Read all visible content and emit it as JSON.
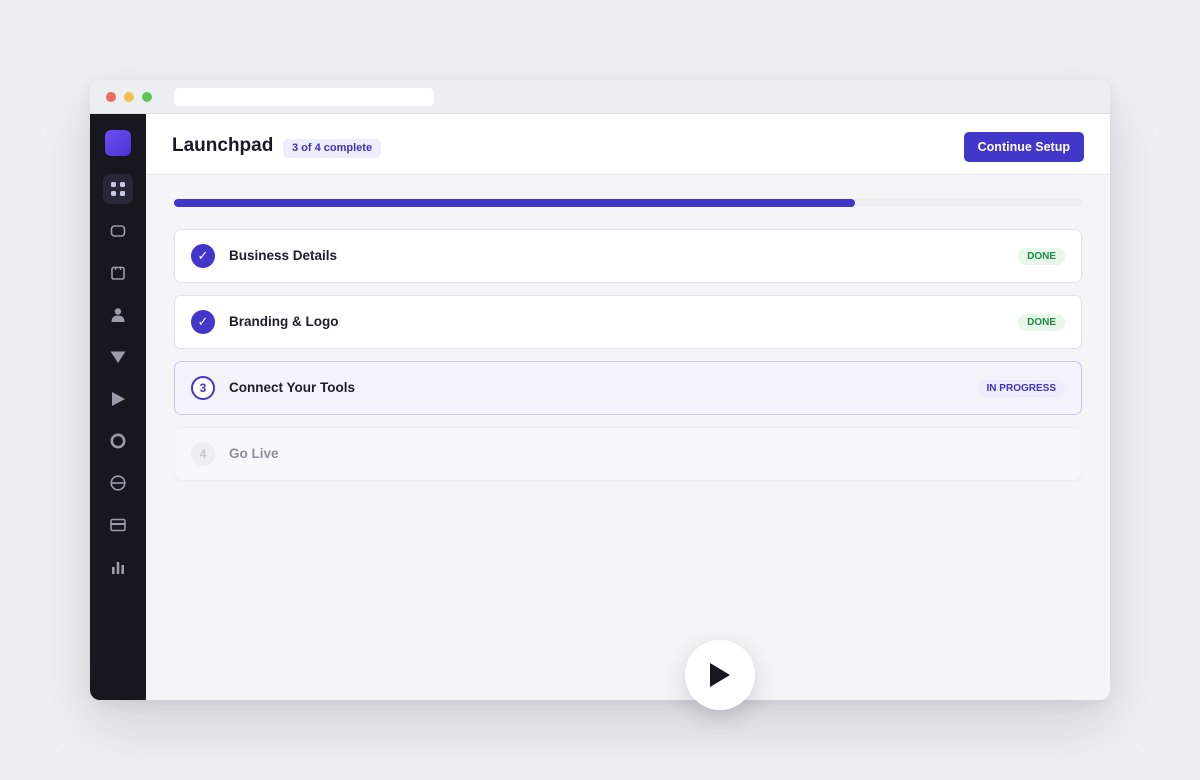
{
  "header": {
    "title": "Launchpad",
    "progress_badge": "3 of 4 complete",
    "cta_label": "Continue Setup"
  },
  "progress": {
    "fraction": 0.75
  },
  "steps": [
    {
      "marker": "✓",
      "title": "Business Details",
      "status": "DONE",
      "state": "done"
    },
    {
      "marker": "✓",
      "title": "Branding & Logo",
      "status": "DONE",
      "state": "done"
    },
    {
      "marker": "3",
      "title": "Connect Your Tools",
      "status": "IN PROGRESS",
      "state": "active"
    },
    {
      "marker": "4",
      "title": "Go Live",
      "status": "",
      "state": "pending"
    }
  ],
  "sidebar": {
    "icons": [
      "grid-icon",
      "chat-icon",
      "calendar-icon",
      "user-icon",
      "filter-icon",
      "play-icon",
      "circle-icon",
      "no-entry-icon",
      "card-icon",
      "bar-chart-icon"
    ]
  },
  "colors": {
    "accent": "#4237c8",
    "sidebar": "#16171f",
    "done_text": "#1e8a45"
  }
}
